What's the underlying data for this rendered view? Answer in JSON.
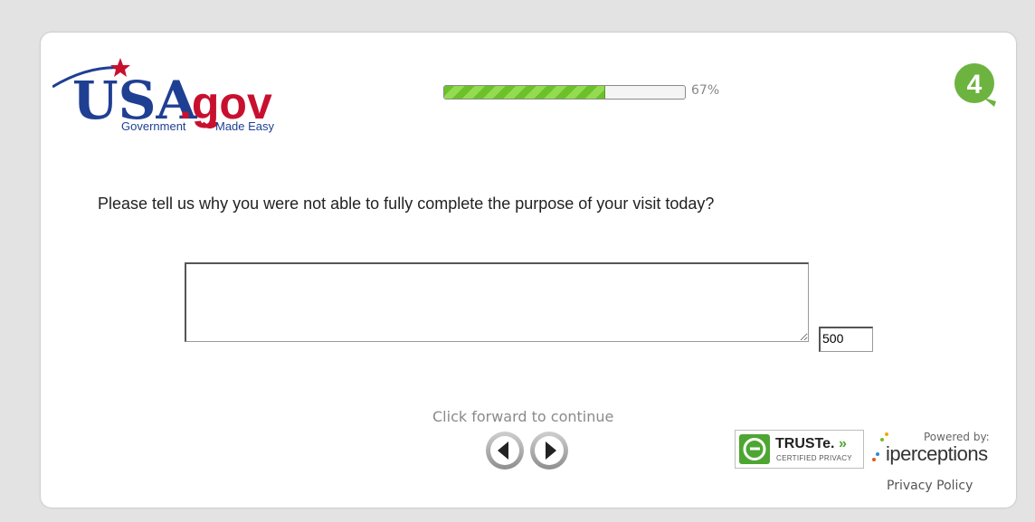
{
  "header": {
    "logo": {
      "brand_left": "USA",
      "brand_right": ".gov",
      "tagline_left": "Government",
      "tagline_right": "Made Easy"
    },
    "progress": {
      "value": 0.67,
      "label": "67%"
    },
    "badge": {
      "text": "4",
      "color": "#6db33f"
    }
  },
  "survey": {
    "question": "Please tell us why you were not able to fully complete the purpose of your visit today?",
    "answer": {
      "value": "",
      "placeholder": ""
    },
    "char_counter": "500"
  },
  "navigation": {
    "prompt": "Click forward to continue",
    "back_icon": "arrow-left-icon",
    "forward_icon": "arrow-right-icon"
  },
  "footer": {
    "truste": {
      "name": "TRUSTe.",
      "arrows": "»",
      "certification": "CERTIFIED PRIVACY"
    },
    "powered_by": "Powered by:",
    "vendor": "iperceptions",
    "privacy_link": "Privacy Policy"
  },
  "colors": {
    "page_bg": "#e3e3e3",
    "progress_green": "#6cc12a",
    "brand_blue": "#1f3f93",
    "brand_red": "#c8102e",
    "truste_green": "#4da632"
  }
}
